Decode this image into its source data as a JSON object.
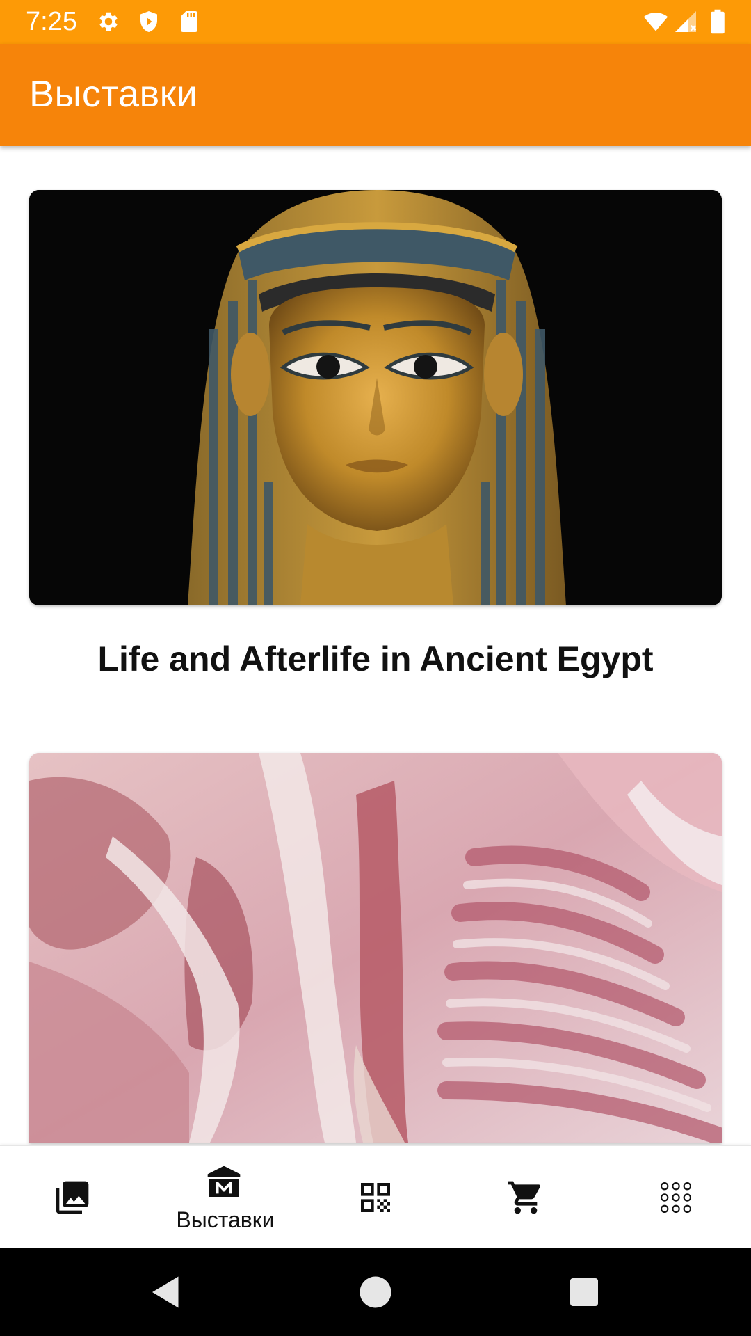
{
  "status_bar": {
    "time": "7:25",
    "icons_left": [
      "settings-icon",
      "shield-icon",
      "sd-card-icon"
    ],
    "icons_right": [
      "wifi-icon",
      "signal-icon",
      "battery-icon"
    ]
  },
  "app_bar": {
    "title": "Выставки",
    "color": "#f6840a"
  },
  "exhibitions": [
    {
      "title": "Life and Afterlife in Ancient Egypt",
      "image": "golden-mummy-mask-image"
    },
    {
      "title": "",
      "image": "anatomy-tissue-image"
    }
  ],
  "bottom_nav": {
    "items": [
      {
        "icon": "gallery-icon",
        "label": ""
      },
      {
        "icon": "museum-icon",
        "label": "Выставки",
        "active": true
      },
      {
        "icon": "qr-code-icon",
        "label": ""
      },
      {
        "icon": "cart-icon",
        "label": ""
      },
      {
        "icon": "apps-grid-icon",
        "label": ""
      }
    ]
  },
  "system_nav": [
    "back-icon",
    "home-icon",
    "recents-icon"
  ]
}
